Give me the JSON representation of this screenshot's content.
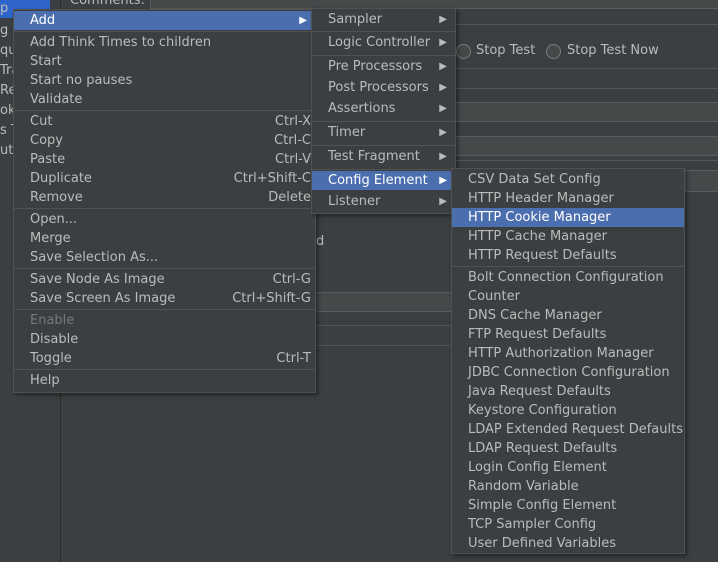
{
  "background": {
    "tree_items": [
      "p",
      "g",
      "qu",
      "Tra",
      "Res",
      "oki",
      "s T",
      "ut S"
    ],
    "comments_label": "Comments:",
    "radio_stop_test": "Stop Test",
    "radio_stop_test_now": "Stop Test Now",
    "partial_text": "ed"
  },
  "main_menu": [
    {
      "label": "Add",
      "submenu": true,
      "selected": true
    },
    {
      "label": "Add Think Times to children"
    },
    {
      "label": "Start"
    },
    {
      "label": "Start no pauses"
    },
    {
      "label": "Validate"
    },
    {
      "label": "Cut",
      "shortcut": "Ctrl-X"
    },
    {
      "label": "Copy",
      "shortcut": "Ctrl-C"
    },
    {
      "label": "Paste",
      "shortcut": "Ctrl-V"
    },
    {
      "label": "Duplicate",
      "shortcut": "Ctrl+Shift-C"
    },
    {
      "label": "Remove",
      "shortcut": "Delete"
    },
    {
      "label": "Open..."
    },
    {
      "label": "Merge"
    },
    {
      "label": "Save Selection As..."
    },
    {
      "label": "Save Node As Image",
      "shortcut": "Ctrl-G"
    },
    {
      "label": "Save Screen As Image",
      "shortcut": "Ctrl+Shift-G"
    },
    {
      "label": "Enable",
      "disabled": true
    },
    {
      "label": "Disable"
    },
    {
      "label": "Toggle",
      "shortcut": "Ctrl-T"
    },
    {
      "label": "Help"
    }
  ],
  "add_menu": [
    {
      "label": "Sampler",
      "submenu": true
    },
    {
      "label": "Logic Controller",
      "submenu": true
    },
    {
      "label": "Pre Processors",
      "submenu": true
    },
    {
      "label": "Post Processors",
      "submenu": true
    },
    {
      "label": "Assertions",
      "submenu": true
    },
    {
      "label": "Timer",
      "submenu": true
    },
    {
      "label": "Test Fragment",
      "submenu": true
    },
    {
      "label": "Config Element",
      "submenu": true,
      "selected": true
    },
    {
      "label": "Listener",
      "submenu": true
    }
  ],
  "config_menu": [
    {
      "label": "CSV Data Set Config"
    },
    {
      "label": "HTTP Header Manager"
    },
    {
      "label": "HTTP Cookie Manager",
      "selected": true
    },
    {
      "label": "HTTP Cache Manager"
    },
    {
      "label": "HTTP Request Defaults"
    },
    {
      "label": "Bolt Connection Configuration"
    },
    {
      "label": "Counter"
    },
    {
      "label": "DNS Cache Manager"
    },
    {
      "label": "FTP Request Defaults"
    },
    {
      "label": "HTTP Authorization Manager"
    },
    {
      "label": "JDBC Connection Configuration"
    },
    {
      "label": "Java Request Defaults"
    },
    {
      "label": "Keystore Configuration"
    },
    {
      "label": "LDAP Extended Request Defaults"
    },
    {
      "label": "LDAP Request Defaults"
    },
    {
      "label": "Login Config Element"
    },
    {
      "label": "Random Variable"
    },
    {
      "label": "Simple Config Element"
    },
    {
      "label": "TCP Sampler Config"
    },
    {
      "label": "User Defined Variables"
    }
  ],
  "colors": {
    "background": "#3c3f41",
    "selection": "#4b6eaf",
    "tree_selection": "#2f65ca",
    "text": "#bbbbbb",
    "disabled_text": "#777777"
  }
}
